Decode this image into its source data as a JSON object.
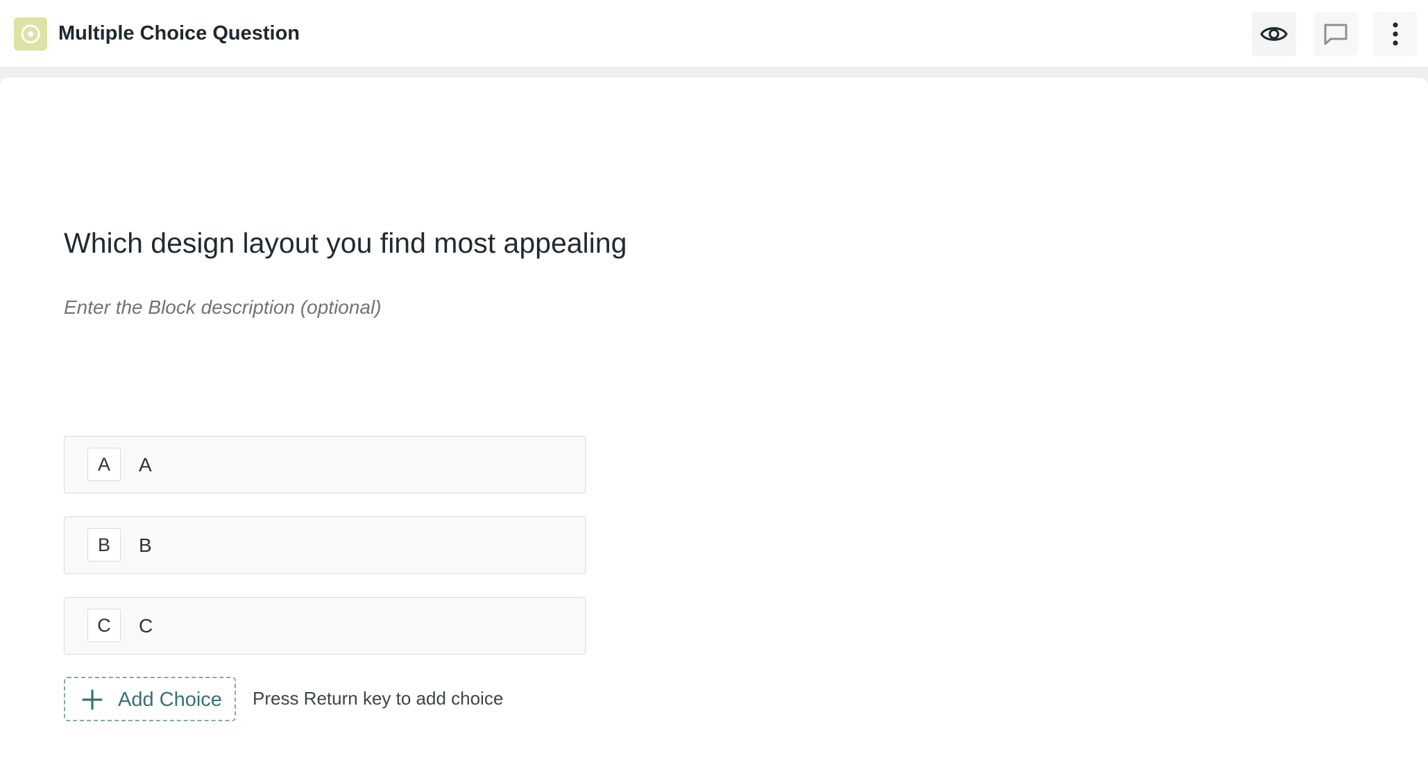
{
  "header": {
    "block_icon": "target-circle-icon",
    "title": "Multiple Choice Question",
    "actions": [
      {
        "name": "preview",
        "icon": "eye-icon"
      },
      {
        "name": "comments",
        "icon": "speech-bubble-icon"
      },
      {
        "name": "more",
        "icon": "kebab-menu-icon"
      }
    ]
  },
  "question": {
    "title": "Which design layout you find most appealing",
    "description_placeholder": "Enter the Block description (optional)"
  },
  "choices": [
    {
      "key": "A",
      "label": "A"
    },
    {
      "key": "B",
      "label": "B"
    },
    {
      "key": "C",
      "label": "C"
    }
  ],
  "add_choice": {
    "label": "Add Choice",
    "icon": "plus-icon",
    "hint": "Press Return key to add choice"
  },
  "colors": {
    "block_icon_bg": "#dfe2a4",
    "accent": "#3a6f77",
    "canvas_bg": "#ffffff",
    "page_bg": "#efefef"
  }
}
